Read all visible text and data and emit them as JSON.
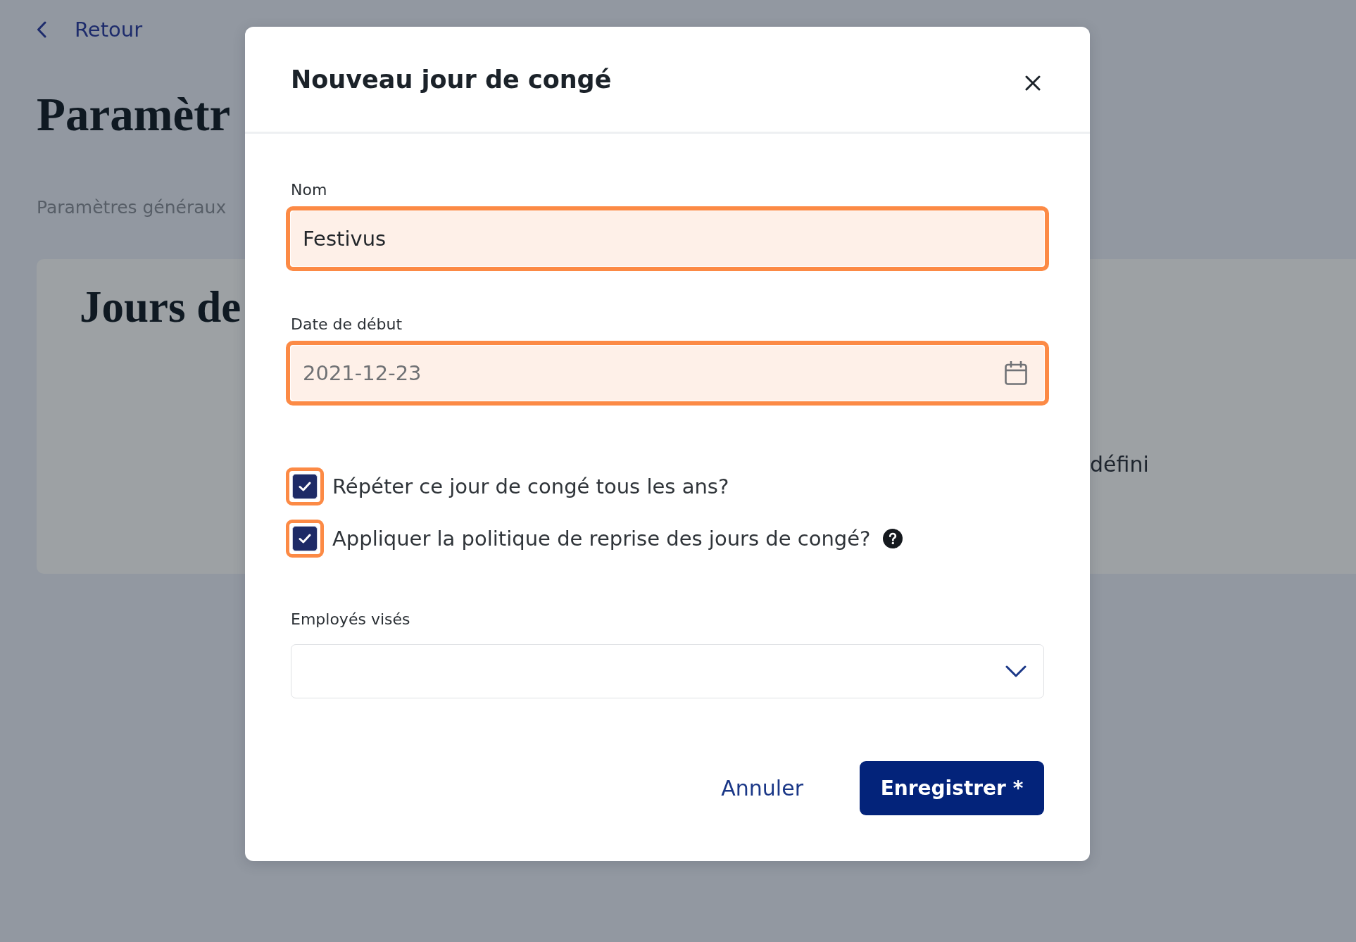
{
  "page": {
    "back_link": "Retour",
    "title": "Paramètr",
    "breadcrumb": "Paramètres généraux",
    "card": {
      "title": "Jours de",
      "text": "défini"
    }
  },
  "dialog": {
    "title": "Nouveau jour de congé",
    "fields": [
      {
        "kind": "text",
        "label": "Nom",
        "value": "Festivus",
        "highlighted": true
      },
      {
        "kind": "date",
        "label": "Date de début",
        "value": "2021-12-23",
        "highlighted": true
      }
    ],
    "checkboxes": [
      {
        "label": "Répéter ce jour de congé tous les ans?",
        "checked": true,
        "highlighted": true,
        "help": false
      },
      {
        "label": "Appliquer la politique de reprise des jours de congé?",
        "checked": true,
        "highlighted": true,
        "help": true
      }
    ],
    "dropdown": {
      "label": "Employés visés"
    },
    "buttons": [
      {
        "kind": "link",
        "label": "Annuler"
      },
      {
        "kind": "primary",
        "label": "Enregistrer *"
      }
    ]
  }
}
